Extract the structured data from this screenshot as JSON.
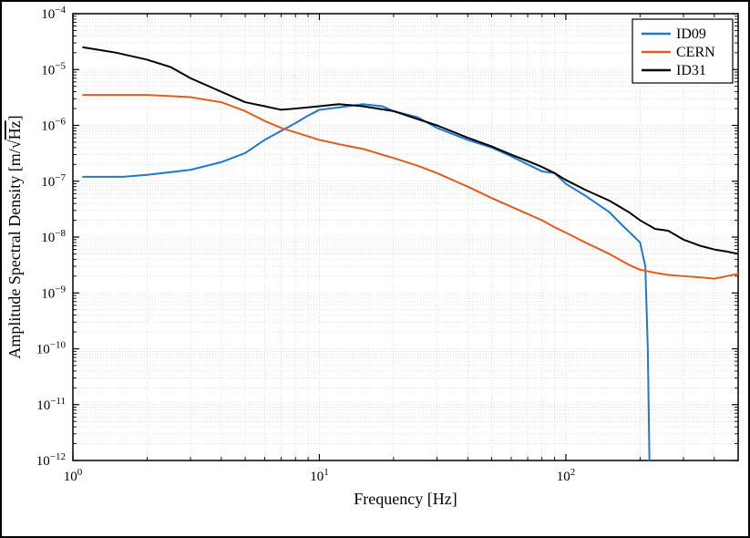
{
  "chart_data": {
    "type": "line",
    "title": "",
    "xlabel": "Frequency [Hz]",
    "ylabel": "Amplitude Spectral Density [m/√Hz]",
    "xscale": "log",
    "yscale": "log",
    "xlim": [
      1,
      500
    ],
    "ylim": [
      1e-12,
      0.0001
    ],
    "xticks": [
      1,
      10,
      100
    ],
    "yticks": [
      1e-12,
      1e-11,
      1e-10,
      1e-09,
      1e-08,
      1e-07,
      1e-06,
      1e-05,
      0.0001
    ],
    "series": [
      {
        "name": "ID09",
        "color": "#1f77d4",
        "x": [
          1.1,
          1.6,
          2,
          3,
          4,
          5,
          6,
          7,
          8,
          9,
          10,
          12,
          15,
          18,
          20,
          25,
          30,
          40,
          50,
          60,
          70,
          80,
          90,
          100,
          120,
          150,
          170,
          190,
          200,
          210,
          215,
          220
        ],
        "y": [
          1.2e-07,
          1.2e-07,
          1.3e-07,
          1.6e-07,
          2.2e-07,
          3.2e-07,
          5.5e-07,
          8e-07,
          1.1e-06,
          1.5e-06,
          1.9e-06,
          2.1e-06,
          2.4e-06,
          2.2e-06,
          1.8e-06,
          1.4e-06,
          9e-07,
          5.5e-07,
          4e-07,
          2.8e-07,
          2e-07,
          1.5e-07,
          1.4e-07,
          9e-08,
          5.5e-08,
          2.8e-08,
          1.6e-08,
          1e-08,
          8e-09,
          3e-09,
          1e-10,
          1e-13
        ]
      },
      {
        "name": "CERN",
        "color": "#e85a1a",
        "x": [
          1.1,
          1.5,
          2,
          3,
          4,
          5,
          6,
          7,
          8,
          10,
          12,
          15,
          20,
          25,
          30,
          40,
          50,
          60,
          70,
          80,
          90,
          100,
          120,
          150,
          180,
          200,
          230,
          260,
          300,
          350,
          400,
          450,
          500
        ],
        "y": [
          3.5e-06,
          3.5e-06,
          3.5e-06,
          3.2e-06,
          2.6e-06,
          1.8e-06,
          1.2e-06,
          9e-07,
          7.5e-07,
          5.5e-07,
          4.6e-07,
          3.8e-07,
          2.6e-07,
          1.9e-07,
          1.4e-07,
          8e-08,
          5e-08,
          3.5e-08,
          2.6e-08,
          2e-08,
          1.5e-08,
          1.2e-08,
          8e-09,
          5e-09,
          3.2e-09,
          2.6e-09,
          2.3e-09,
          2.1e-09,
          2e-09,
          1.9e-09,
          1.8e-09,
          2e-09,
          2.2e-09
        ]
      },
      {
        "name": "ID31",
        "color": "#000000",
        "x": [
          1.1,
          1.5,
          2,
          2.5,
          3,
          4,
          5,
          6,
          7,
          8,
          10,
          12,
          15,
          20,
          25,
          30,
          40,
          50,
          60,
          70,
          80,
          90,
          100,
          120,
          150,
          180,
          200,
          230,
          260,
          300,
          350,
          400,
          450,
          500
        ],
        "y": [
          2.5e-05,
          2e-05,
          1.5e-05,
          1.1e-05,
          7e-06,
          4e-06,
          2.6e-06,
          2.2e-06,
          1.9e-06,
          2e-06,
          2.2e-06,
          2.4e-06,
          2.2e-06,
          1.8e-06,
          1.3e-06,
          1e-06,
          6e-07,
          4.2e-07,
          3e-07,
          2.3e-07,
          1.8e-07,
          1.4e-07,
          1.05e-07,
          7e-08,
          4.5e-08,
          2.8e-08,
          2e-08,
          1.4e-08,
          1.3e-08,
          9e-09,
          7e-09,
          6e-09,
          5.5e-09,
          5e-09
        ]
      }
    ],
    "legend": {
      "position": "upper right",
      "entries": [
        "ID09",
        "CERN",
        "ID31"
      ]
    },
    "grid": true
  }
}
